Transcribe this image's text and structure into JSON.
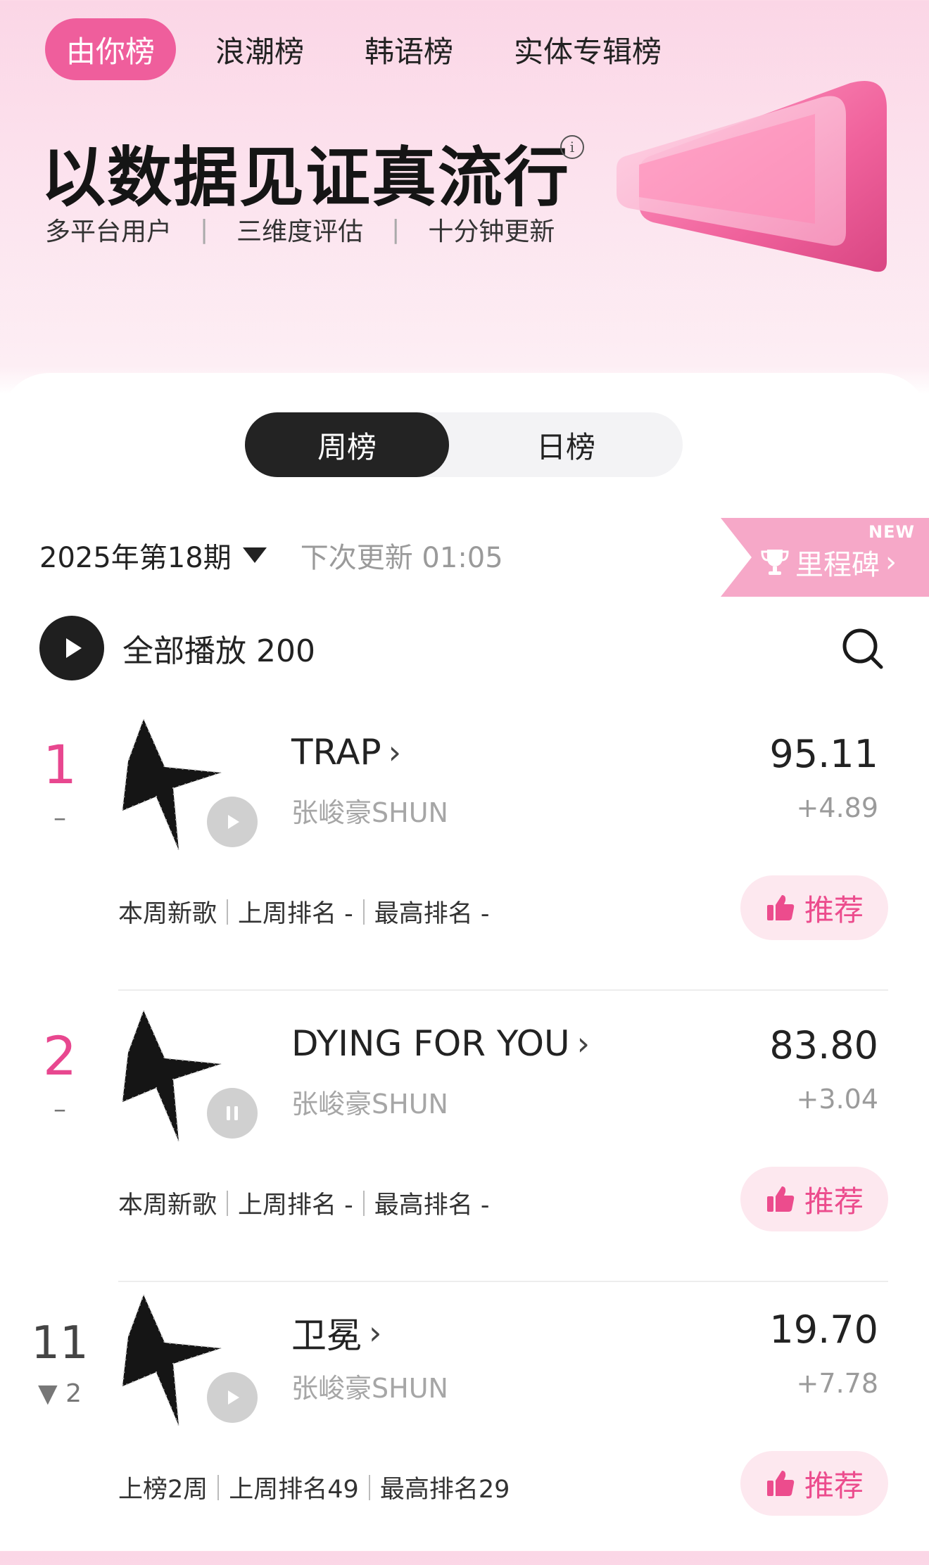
{
  "top_tabs": [
    {
      "label": "由你榜",
      "active": true
    },
    {
      "label": "浪潮榜",
      "active": false
    },
    {
      "label": "韩语榜",
      "active": false
    },
    {
      "label": "实体专辑榜",
      "active": false
    }
  ],
  "hero": {
    "title": "以数据见证真流行",
    "info_icon": "info-icon",
    "features": [
      "多平台用户",
      "三维度评估",
      "十分钟更新"
    ]
  },
  "segmented": {
    "week": "周榜",
    "day": "日榜",
    "selected": "周榜"
  },
  "period": {
    "label": "2025年第18期",
    "next_update": "下次更新 01:05"
  },
  "milestone": {
    "badge": "NEW",
    "label": "里程碑",
    "icon": "trophy-icon"
  },
  "play_all": {
    "label": "全部播放 200",
    "icon": "play-icon"
  },
  "songs": [
    {
      "rank": "1",
      "rank_change": "–",
      "title": "TRAP",
      "artist": "张峻豪SHUN",
      "score": "95.11",
      "delta": "+4.89",
      "playing": false,
      "meta": [
        "本周新歌",
        "上周排名 -",
        "最高排名 -"
      ],
      "recommend": "推荐"
    },
    {
      "rank": "2",
      "rank_change": "–",
      "title": "DYING FOR YOU",
      "artist": "张峻豪SHUN",
      "score": "83.80",
      "delta": "+3.04",
      "playing": true,
      "meta": [
        "本周新歌",
        "上周排名 -",
        "最高排名 -"
      ],
      "recommend": "推荐"
    },
    {
      "rank": "11",
      "rank_change": "▼ 2",
      "title": "卫冕",
      "artist": "张峻豪SHUN",
      "score": "19.70",
      "delta": "+7.78",
      "playing": false,
      "meta": [
        "上榜2周",
        "上周排名49",
        "最高排名29"
      ],
      "recommend": "推荐"
    }
  ],
  "colors": {
    "accent_pink": "#ef5e9c",
    "rank_pink": "#e8478f",
    "recommend_bg": "#fde8ef"
  }
}
